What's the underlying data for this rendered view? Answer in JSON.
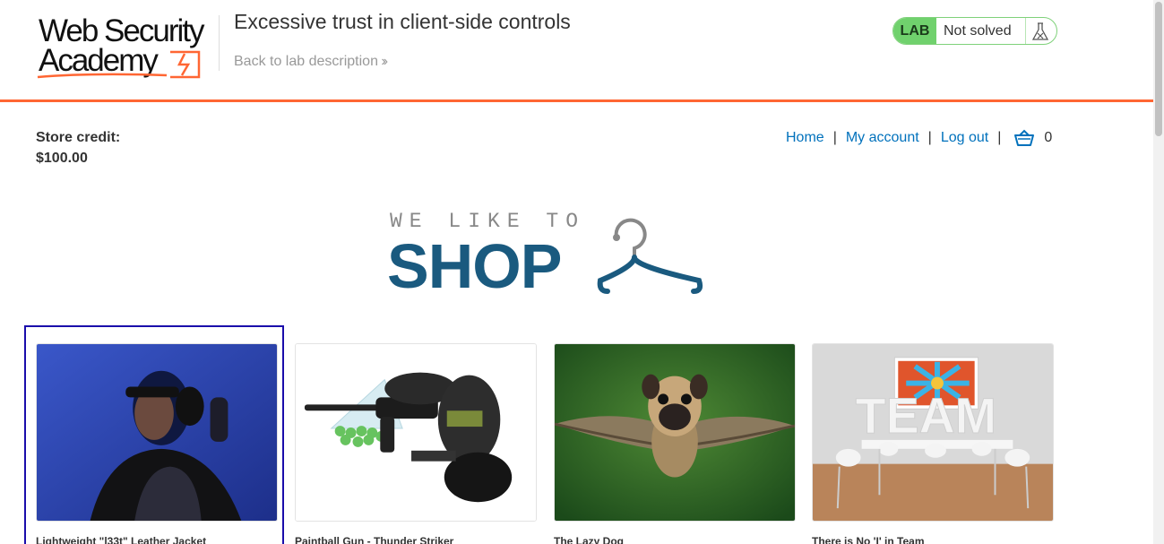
{
  "header": {
    "logo_line1": "Web Security",
    "logo_line2": "Academy",
    "lab_title": "Excessive trust in client-side controls",
    "back_link": "Back to lab description",
    "badge_label": "LAB",
    "badge_status": "Not solved",
    "accent_color": "#ff6633",
    "badge_color": "#70d16d"
  },
  "store": {
    "credit_label": "Store credit:",
    "credit_value": "$100.00"
  },
  "nav": {
    "home": "Home",
    "account": "My account",
    "logout": "Log out",
    "separator": "|",
    "cart_count": "0",
    "link_color": "#0071bc"
  },
  "banner": {
    "subtitle": "WE LIKE TO",
    "title": "SHOP"
  },
  "products": [
    {
      "title": "Lightweight \"l33t\" Leather Jacket",
      "image_icon": "jacket-photo"
    },
    {
      "title": "Paintball Gun - Thunder Striker",
      "image_icon": "paintball-gun-photo"
    },
    {
      "title": "The Lazy Dog",
      "image_icon": "flying-pug-photo"
    },
    {
      "title": "There is No 'I' in Team",
      "image_icon": "team-sign-photo"
    }
  ]
}
